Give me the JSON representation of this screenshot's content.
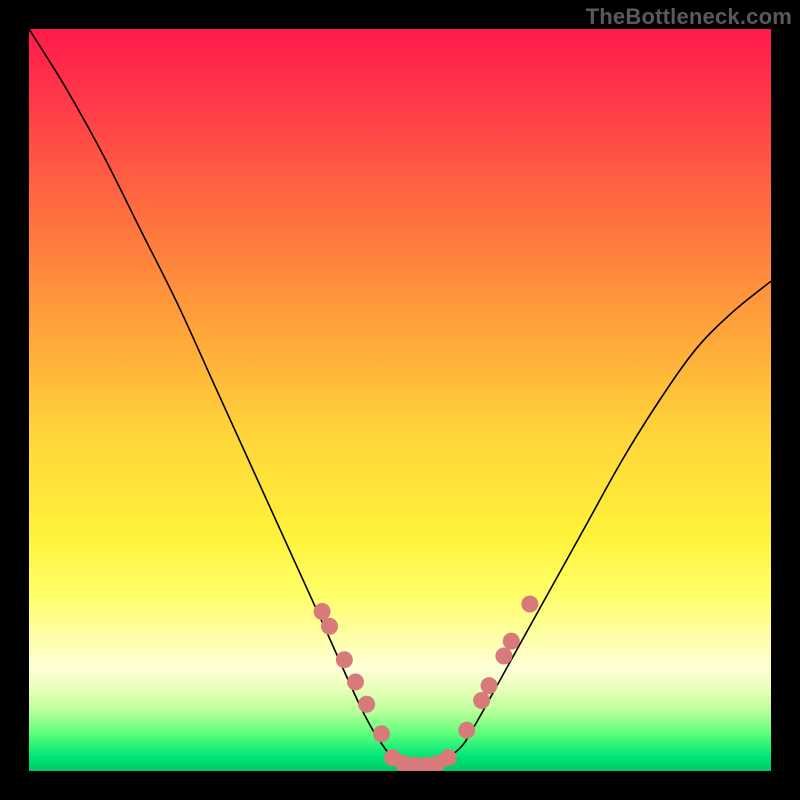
{
  "watermark": "TheBottleneck.com",
  "chart_data": {
    "type": "line",
    "title": "",
    "xlabel": "",
    "ylabel": "",
    "xlim": [
      0,
      100
    ],
    "ylim": [
      0,
      100
    ],
    "grid": false,
    "series": [
      {
        "name": "curve",
        "x": [
          0,
          5,
          10,
          15,
          20,
          25,
          30,
          35,
          40,
          45,
          48,
          50,
          52,
          55,
          58,
          60,
          65,
          70,
          75,
          80,
          85,
          90,
          95,
          100
        ],
        "y": [
          100,
          92,
          83,
          73,
          63,
          52,
          41,
          30,
          19,
          8,
          3,
          1,
          0.5,
          1,
          3,
          6,
          15,
          24,
          33,
          42,
          50,
          57,
          62,
          66
        ]
      }
    ],
    "markers": [
      {
        "name": "left-cluster",
        "points": [
          {
            "x": 39.5,
            "y": 21.5
          },
          {
            "x": 40.5,
            "y": 19.5
          },
          {
            "x": 42.5,
            "y": 15.0
          },
          {
            "x": 44.0,
            "y": 12.0
          },
          {
            "x": 45.5,
            "y": 9.0
          },
          {
            "x": 47.5,
            "y": 5.0
          }
        ]
      },
      {
        "name": "bottom-cluster",
        "points": [
          {
            "x": 49.0,
            "y": 1.8
          },
          {
            "x": 50.5,
            "y": 1.0
          },
          {
            "x": 52.0,
            "y": 0.8
          },
          {
            "x": 53.5,
            "y": 0.8
          },
          {
            "x": 55.0,
            "y": 1.0
          },
          {
            "x": 56.5,
            "y": 1.8
          }
        ]
      },
      {
        "name": "right-cluster",
        "points": [
          {
            "x": 59.0,
            "y": 5.5
          },
          {
            "x": 61.0,
            "y": 9.5
          },
          {
            "x": 62.0,
            "y": 11.5
          },
          {
            "x": 64.0,
            "y": 15.5
          },
          {
            "x": 65.0,
            "y": 17.5
          },
          {
            "x": 67.5,
            "y": 22.5
          }
        ]
      }
    ],
    "gradient_stops": [
      {
        "pos": 0,
        "color": "#ff1a4b"
      },
      {
        "pos": 25,
        "color": "#ff6f3f"
      },
      {
        "pos": 55,
        "color": "#ffd63a"
      },
      {
        "pos": 82,
        "color": "#ffffa8"
      },
      {
        "pos": 100,
        "color": "#00c864"
      }
    ]
  }
}
